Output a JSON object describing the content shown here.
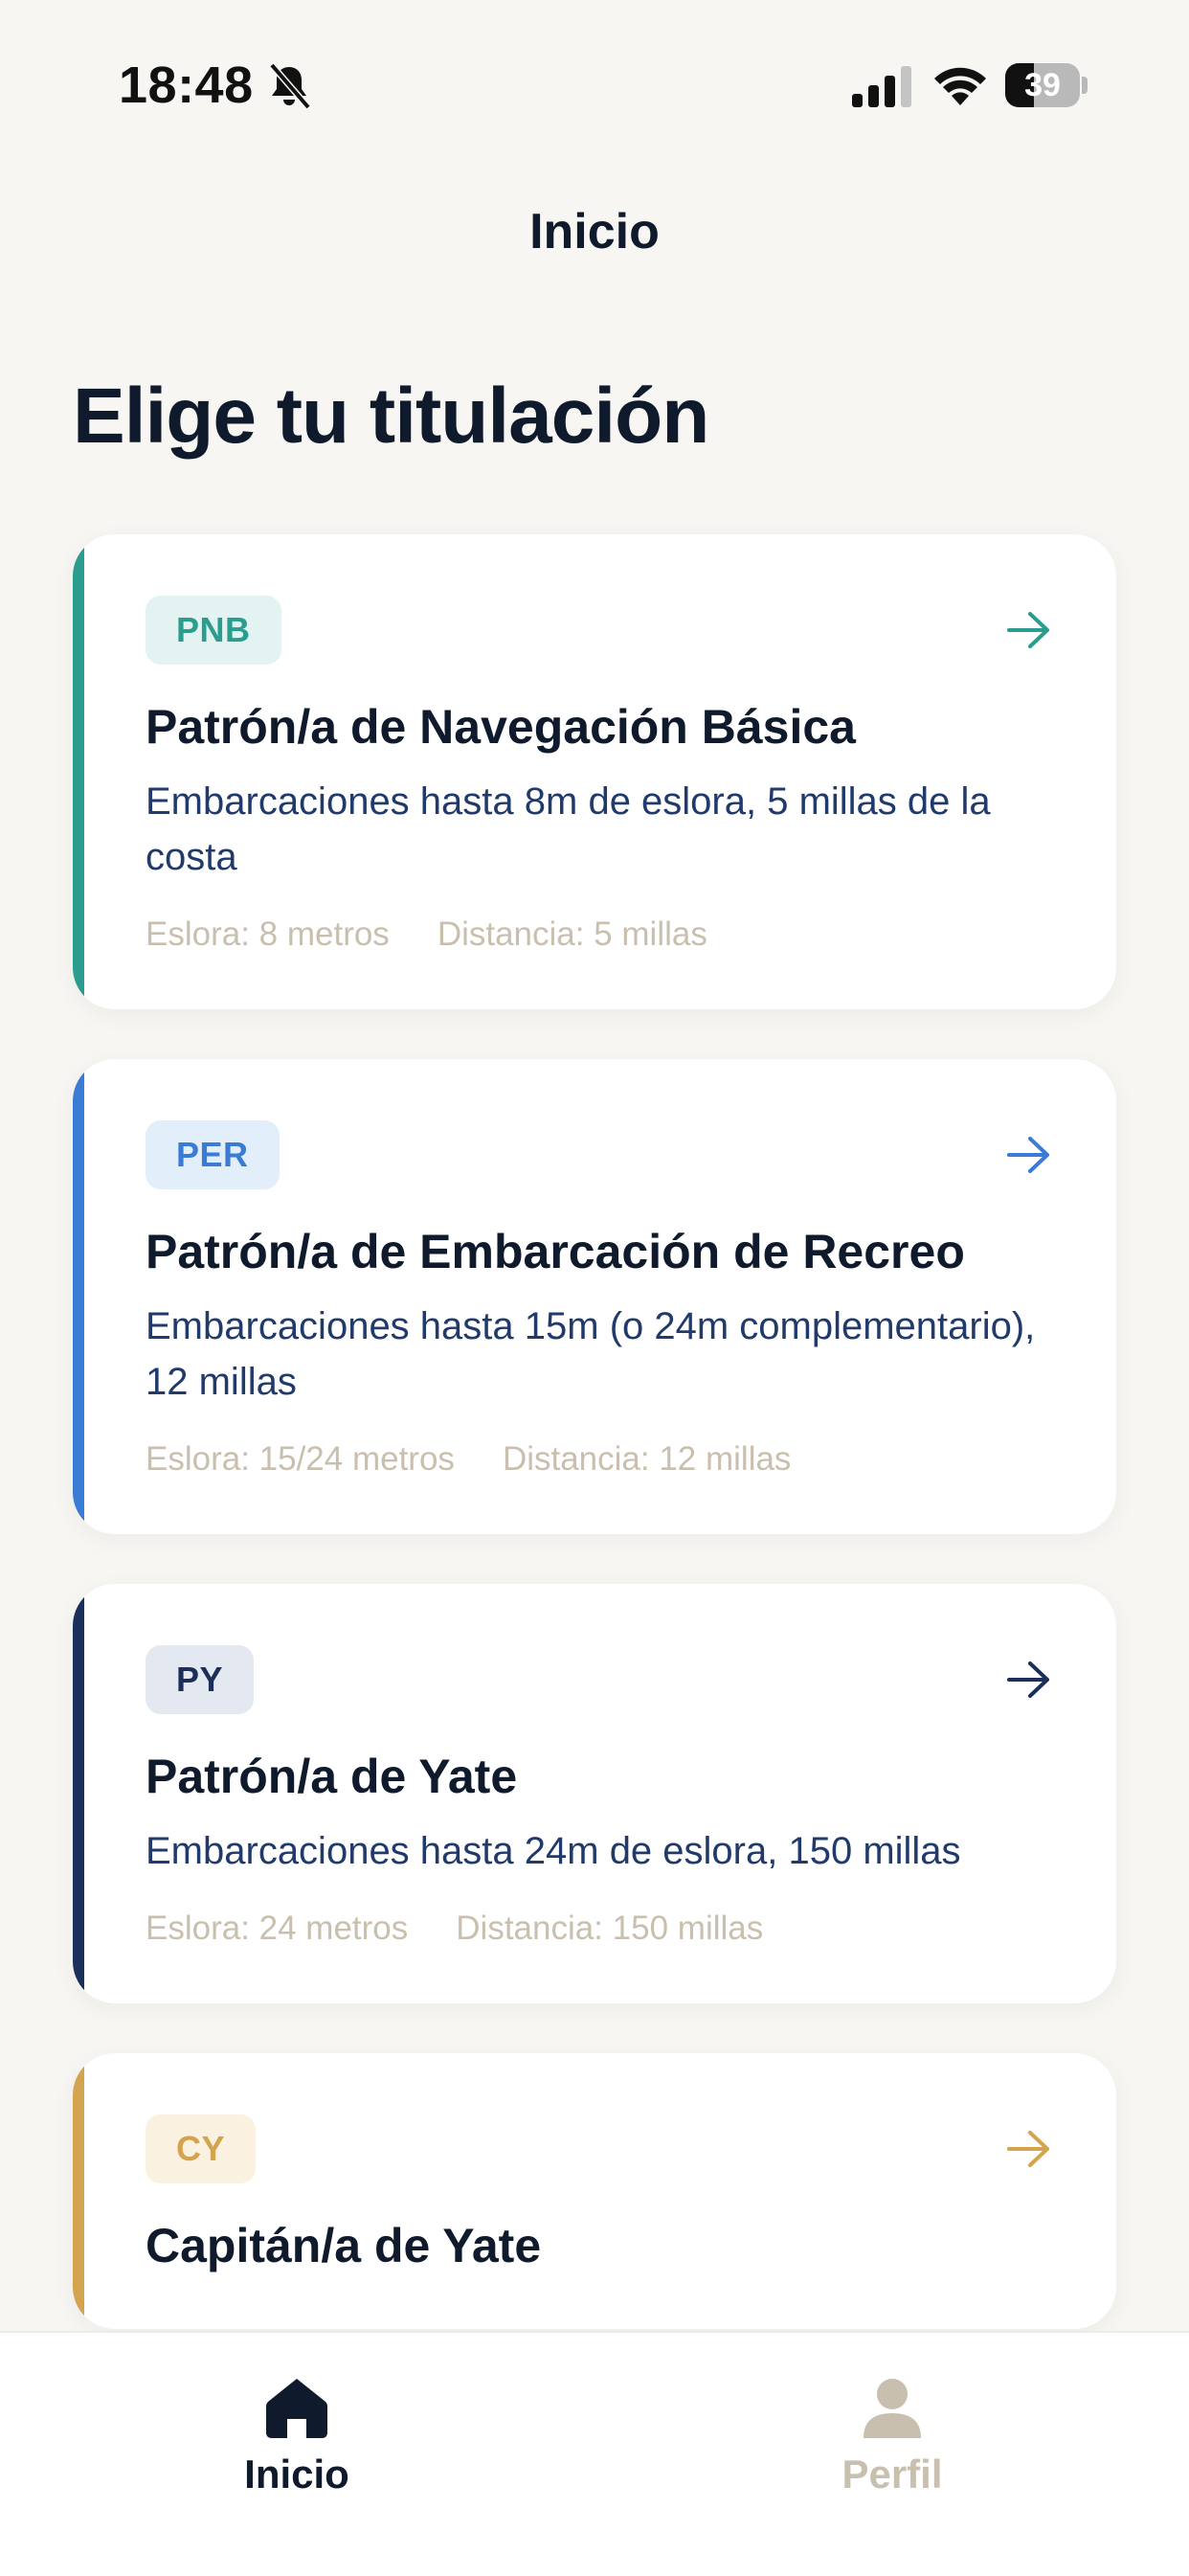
{
  "status_bar": {
    "time": "18:48",
    "battery": "39",
    "battery_level": 0.39
  },
  "header": {
    "title": "Inicio"
  },
  "page": {
    "heading": "Elige tu titulación"
  },
  "cards": [
    {
      "badge": "PNB",
      "title": "Patrón/a de Navegación Básica",
      "description": "Embarcaciones hasta 8m de eslora, 5 millas de la costa",
      "length": "Eslora: 8 metros",
      "distance": "Distancia: 5 millas",
      "accent_color": "#2a9d8f",
      "badge_bg": "#e3f3f1"
    },
    {
      "badge": "PER",
      "title": "Patrón/a de Embarcación de Recreo",
      "description": "Embarcaciones hasta 15m (o 24m complementario), 12 millas",
      "length": "Eslora: 15/24 metros",
      "distance": "Distancia: 12 millas",
      "accent_color": "#3a7bd5",
      "badge_bg": "#e3eefb"
    },
    {
      "badge": "PY",
      "title": "Patrón/a de Yate",
      "description": "Embarcaciones hasta 24m de eslora, 150 millas",
      "length": "Eslora: 24 metros",
      "distance": "Distancia: 150 millas",
      "accent_color": "#1c2f5a",
      "badge_bg": "#e3e8f1"
    },
    {
      "badge": "CY",
      "title": "Capitán/a de Yate",
      "description": "",
      "length": "",
      "distance": "",
      "accent_color": "#d4a34e",
      "badge_bg": "#fbf1e0"
    }
  ],
  "tab_bar": {
    "items": [
      {
        "label": "Inicio",
        "icon": "home-icon",
        "active": true,
        "color": "#0f1b2d"
      },
      {
        "label": "Perfil",
        "icon": "profile-icon",
        "active": false,
        "color": "#c9bfae"
      }
    ]
  }
}
